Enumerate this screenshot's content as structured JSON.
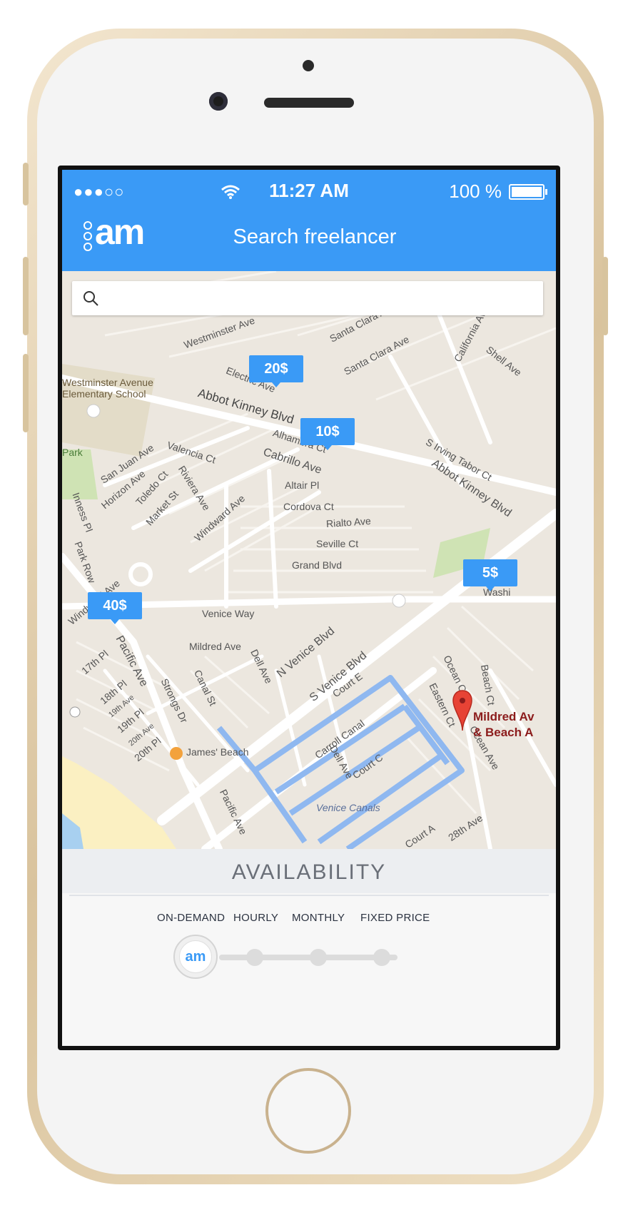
{
  "status_bar": {
    "signal": "●●●○○",
    "time": "11:27 AM",
    "battery": "100 %"
  },
  "header": {
    "logo": "am",
    "title": "Search freelancer"
  },
  "search": {
    "value": "",
    "placeholder": ""
  },
  "map": {
    "markers": [
      {
        "price": "20$"
      },
      {
        "price": "10$"
      },
      {
        "price": "5$"
      },
      {
        "price": "40$"
      }
    ],
    "pin_label": [
      "Mildred Av",
      "& Beach A"
    ],
    "streets": [
      "Westminster Ave",
      "San Juan Ave",
      "Santa Clara Ave",
      "Santa Clara Ave",
      "California Ave",
      "Shell Ave",
      "Electric Ave",
      "Abbot Kinney Blvd",
      "Alhambra Ct",
      "Cabrillo Ave",
      "S Irving Tabor Ct",
      "Abbot Kinney Blvd",
      "Valencia Ct",
      "San Juan Ave",
      "Horizon Ave",
      "Toledo Ct",
      "Riviera Ave",
      "Market St",
      "Windward Ave",
      "Altair Pl",
      "Cordova Ct",
      "Rialto Ave",
      "Seville Ct",
      "Grand Blvd",
      "Venice Way",
      "Mildred Ave",
      "N Venice Blvd",
      "S Venice Blvd",
      "Court E",
      "Eastern Ct",
      "Ocean Ct",
      "Beach Ct",
      "Ocean Ave",
      "Carroll Canal",
      "Dell Ave",
      "Court C",
      "Venice Canals",
      "Court A",
      "28th Ave",
      "Pacific Ave",
      "17th Pl",
      "18th Pl",
      "19th Ave",
      "19th Pl",
      "20th Ave",
      "20th Pl",
      "Strongs Dr",
      "Canal St",
      "Dell Ave",
      "Pacific Ave",
      "James' Beach",
      "Inness Pl",
      "Park Row",
      "Washi",
      "Park",
      "Windward Ave"
    ],
    "poi": [
      "Westminster Avenue",
      "Elementary School"
    ]
  },
  "availability": {
    "title": "AVAILABILITY",
    "options": [
      "ON-DEMAND",
      "HOURLY",
      "MONTHLY",
      "FIXED PRICE"
    ],
    "selected_index": 0,
    "knob_label": "am"
  },
  "colors": {
    "primary": "#3a9af6",
    "pin": "#e74335",
    "map_bg": "#ece7df",
    "road": "#ffffff",
    "canal": "#8fb8f0"
  }
}
